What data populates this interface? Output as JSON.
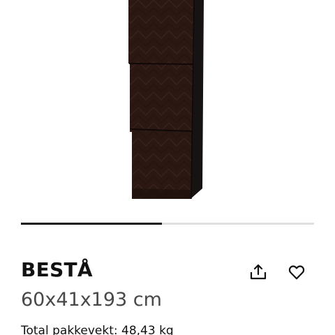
{
  "product": {
    "name": "BESTÅ",
    "dimensions": "60x41x193 cm",
    "package_weight": "Total pakkevekt: 48,43 kg"
  },
  "carousel": {
    "progress": 0.48
  },
  "icons": {
    "share": "share-icon",
    "favorite": "heart-icon"
  },
  "colors": {
    "cabinet": "#2b1812",
    "cabinet_dark": "#1c0f0b",
    "side_panel": "#161312",
    "progress_active": "#111111",
    "progress_track": "#dfdfdf"
  }
}
